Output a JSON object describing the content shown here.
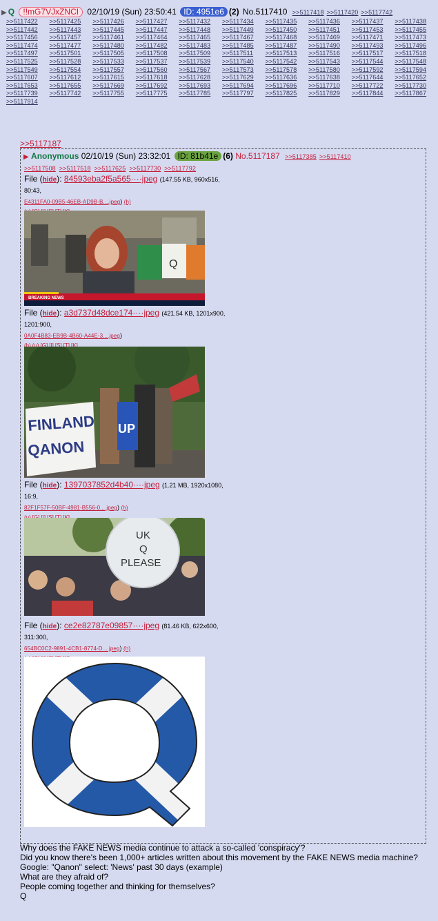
{
  "op": {
    "name": "Q",
    "trip": "!!mG7VJxZNCI",
    "date": "02/10/19 (Sun) 23:50:41",
    "id": "ID: 4951e6",
    "count": "(2)",
    "post_no": "No.5117410",
    "head_refs": [
      ">>5117418",
      ">>5117420",
      ">>5117742"
    ],
    "reply_refs": [
      ">>5117422",
      ">>5117425",
      ">>5117426",
      ">>5117427",
      ">>5117432",
      ">>5117434",
      ">>5117435",
      ">>5117436",
      ">>5117437",
      ">>5117438",
      ">>5117442",
      ">>5117443",
      ">>5117445",
      ">>5117447",
      ">>5117448",
      ">>5117449",
      ">>5117450",
      ">>5117451",
      ">>5117453",
      ">>5117455",
      ">>5117456",
      ">>5117457",
      ">>5117461",
      ">>5117464",
      ">>5117465",
      ">>5117467",
      ">>5117468",
      ">>5117469",
      ">>5117471",
      ">>5117473",
      ">>5117474",
      ">>5117477",
      ">>5117480",
      ">>5117482",
      ">>5117483",
      ">>5117485",
      ">>5117487",
      ">>5117490",
      ">>5117493",
      ">>5117496",
      ">>5117497",
      ">>5117501",
      ">>5117505",
      ">>5117508",
      ">>5117509",
      ">>5117511",
      ">>5117513",
      ">>5117516",
      ">>5117517",
      ">>5117518",
      ">>5117525",
      ">>5117528",
      ">>5117533",
      ">>5117537",
      ">>5117539",
      ">>5117540",
      ">>5117542",
      ">>5117543",
      ">>5117544",
      ">>5117548",
      ">>5117549",
      ">>5117554",
      ">>5117557",
      ">>5117560",
      ">>5117567",
      ">>5117573",
      ">>5117578",
      ">>5117580",
      ">>5117592",
      ">>5117594",
      ">>5117607",
      ">>5117612",
      ">>5117615",
      ">>5117618",
      ">>5117628",
      ">>5117629",
      ">>5117636",
      ">>5117638",
      ">>5117644",
      ">>5117652",
      ">>5117653",
      ">>5117655",
      ">>5117669",
      ">>5117692",
      ">>5117693",
      ">>5117694",
      ">>5117696",
      ">>5117710",
      ">>5117722",
      ">>5117730",
      ">>5117739",
      ">>5117742",
      ">>5117755",
      ">>5117775",
      ">>5117785",
      ">>5117797",
      ">>5117825",
      ">>5117829",
      ">>5117844",
      ">>5117867",
      ">>5117914"
    ]
  },
  "quoted": {
    "link": ">>5117187",
    "name": "Anonymous",
    "date": "02/10/19 (Sun) 23:32:01",
    "id": "ID: 81b41e",
    "count": "(6)",
    "post_no": "No.5117187",
    "head_refs": [
      ">>5117385",
      ">>5117410"
    ],
    "refs": [
      ">>5117508",
      ">>5117518",
      ">>5117625",
      ">>5117730",
      ">>5117792"
    ],
    "files": [
      {
        "label": "File (",
        "hide": "hide",
        "close": "): ",
        "name": "84593eba2f5a565····jpeg",
        "meta": "(147.55 KB, 960x516, 80:43, ",
        "hash": "E4311FA0-09B5-46EB-AD9B-B....jpeg",
        "meta_end": ") ",
        "h": "(h)",
        "tools": [
          "(u)",
          "[G]",
          "[I]",
          "[S]",
          "[T]",
          "[K]"
        ]
      },
      {
        "label": "File (",
        "hide": "hide",
        "close": "): ",
        "name": "a3d737d48dce174····jpeg",
        "meta": "(421.54 KB, 1201x900, 1201:900, ",
        "hash": "0A0F4B83-EB9B-4B60-A44E-3....jpeg",
        "meta_end": ")",
        "h": "",
        "tools": [
          "(h)",
          "(u)",
          "[G]",
          "[I]",
          "[S]",
          "[T]",
          "[K]"
        ]
      },
      {
        "label": "File (",
        "hide": "hide",
        "close": "): ",
        "name": "1397037852d4b40····jpeg",
        "meta": "(1.21 MB, 1920x1080, 16:9, ",
        "hash": "82F1F57F-50BF-4981-B556-0....jpeg",
        "meta_end": ") ",
        "h": "(h)",
        "tools": [
          "(u)",
          "[G]",
          "[I]",
          "[S]",
          "[T]",
          "[K]"
        ]
      },
      {
        "label": "File (",
        "hide": "hide",
        "close": "): ",
        "name": "ce2e82787e09857····jpeg",
        "meta": "(81.46 KB, 622x600, 311:300, ",
        "hash": "654BC0C2-9891-4CB1-8774-D....jpeg",
        "meta_end": ") ",
        "h": "(h)",
        "tools": [
          "(u)",
          "[G]",
          "[I]",
          "[S]",
          "[T]",
          "[K]"
        ]
      }
    ],
    "img1": {
      "ticker": "BREAKING NEWS",
      "flag_letter": "Q"
    },
    "img2": {
      "banner": "FINLAND",
      "banner2": "QANON",
      "blue_sign": "UP"
    },
    "img3": {
      "sign_l1": "UK",
      "sign_l2": "Q",
      "sign_l3": "PLEASE"
    },
    "img4": {
      "letter": "Q"
    }
  },
  "body": [
    "Why does the FAKE NEWS media continue to attack a so-called 'conspiracy'?",
    "Did you know there's been 1,000+ articles written about this movement by the FAKE NEWS media machine?",
    "Google: \"Qanon\" select: 'News' past 30 days (example)",
    "What are they afraid of?",
    "People coming together and thinking for themselves?",
    "Q"
  ]
}
